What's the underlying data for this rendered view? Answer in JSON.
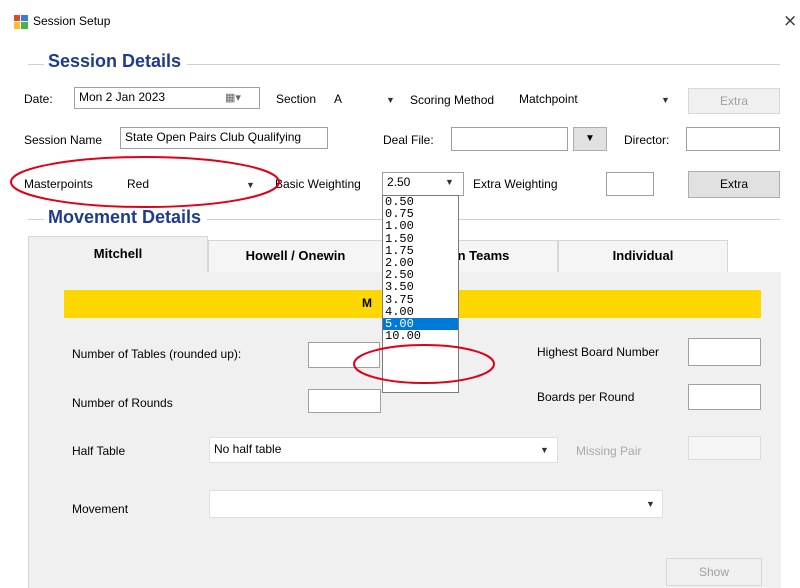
{
  "window": {
    "title": "Session Setup",
    "close_glyph": "×"
  },
  "session_details": {
    "heading": "Session Details",
    "date_label": "Date:",
    "date_value": "Mon  2 Jan 2023",
    "section_label": "Section",
    "section_value": "A",
    "scoring_label": "Scoring Method",
    "scoring_value": "Matchpoint",
    "extra_top_label": "Extra",
    "session_name_label": "Session Name",
    "session_name_value": "State Open Pairs Club Qualifying",
    "deal_file_label": "Deal File:",
    "deal_file_value": "",
    "director_label": "Director:",
    "director_value": "",
    "masterpoints_label": "Masterpoints",
    "masterpoints_value": "Red",
    "basic_weighting_label": "Basic Weighting",
    "basic_weighting_value": "2.50",
    "extra_weighting_label": "Extra Weighting",
    "extra_weighting_value": "",
    "extra_button_label": "Extra"
  },
  "weighting_dropdown": {
    "options": [
      "0.50",
      "0.75",
      "1.00",
      "1.50",
      "1.75",
      "2.00",
      "2.50",
      "3.50",
      "3.75",
      "4.00",
      "5.00",
      "10.00"
    ],
    "selected": "5.00"
  },
  "movement_details": {
    "heading": "Movement Details",
    "tabs": [
      {
        "label": "Mitchell",
        "active": true
      },
      {
        "label": "Howell / Onewin",
        "active": false
      },
      {
        "label": "ssion Teams",
        "active": false
      },
      {
        "label": "Individual",
        "active": false
      }
    ],
    "band_title": "M",
    "num_tables_label": "Number of Tables (rounded up):",
    "num_rounds_label": "Number of Rounds",
    "highest_board_label": "Highest Board Number",
    "boards_per_round_label": "Boards per Round",
    "half_table_label": "Half Table",
    "half_table_value": "No half table",
    "missing_pair_label": "Missing Pair",
    "movement_label": "Movement",
    "movement_value": "",
    "show_button_label": "Show"
  },
  "colors": {
    "accent_heading": "#1f3b8c",
    "band": "#ffd700",
    "annotation": "#e0001a",
    "selection": "#0078d7"
  }
}
